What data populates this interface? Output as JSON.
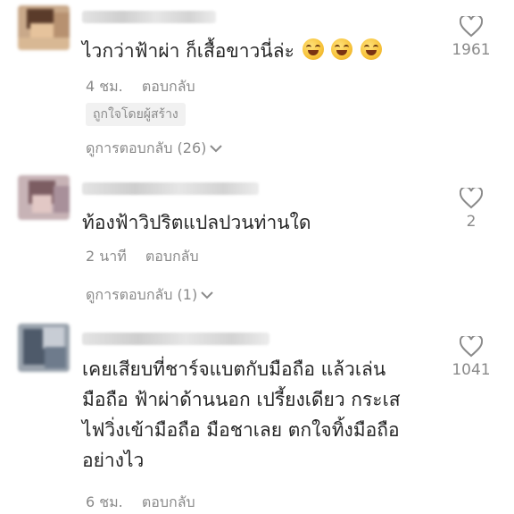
{
  "comments": [
    {
      "text": "ไวกว่าฟ้าผ่า ก็เสื้อขาวนี่ล่ะ",
      "emoji_count": 3,
      "emoji_name": "grinning-sweat-emoji",
      "time": "4 ชม.",
      "reply_label": "ตอบกลับ",
      "badge": "ถูกใจโดยผู้สร้าง",
      "view_replies": "ดูการตอบกลับ (26)",
      "likes": "1961"
    },
    {
      "text": "ท้องฟ้าวิปริตแปลปวนท่านใด",
      "time": "2 นาที",
      "reply_label": "ตอบกลับ",
      "view_replies": "ดูการตอบกลับ (1)",
      "likes": "2"
    },
    {
      "text_lines": [
        "เคยเสียบที่ชาร์จแบตกับมือถือ แล้วเล่น",
        "มือถือ ฟ้าผ่าด้านนอก เปรี้ยงเดียว กระเส",
        "ไฟวิ่งเข้ามือถือ มือชาเลย ตกใจทิ้งมือถือ",
        "อย่างไว"
      ],
      "time": "6 ชม.",
      "reply_label": "ตอบกลับ",
      "likes": "1041"
    }
  ],
  "colors": {
    "text": "#262626",
    "meta": "#8a8a8a",
    "heart_outline": "#8a8a8a",
    "badge_bg": "#f1f1f1"
  },
  "icons": {
    "like": "heart-outline-icon",
    "expand": "chevron-down-icon"
  }
}
